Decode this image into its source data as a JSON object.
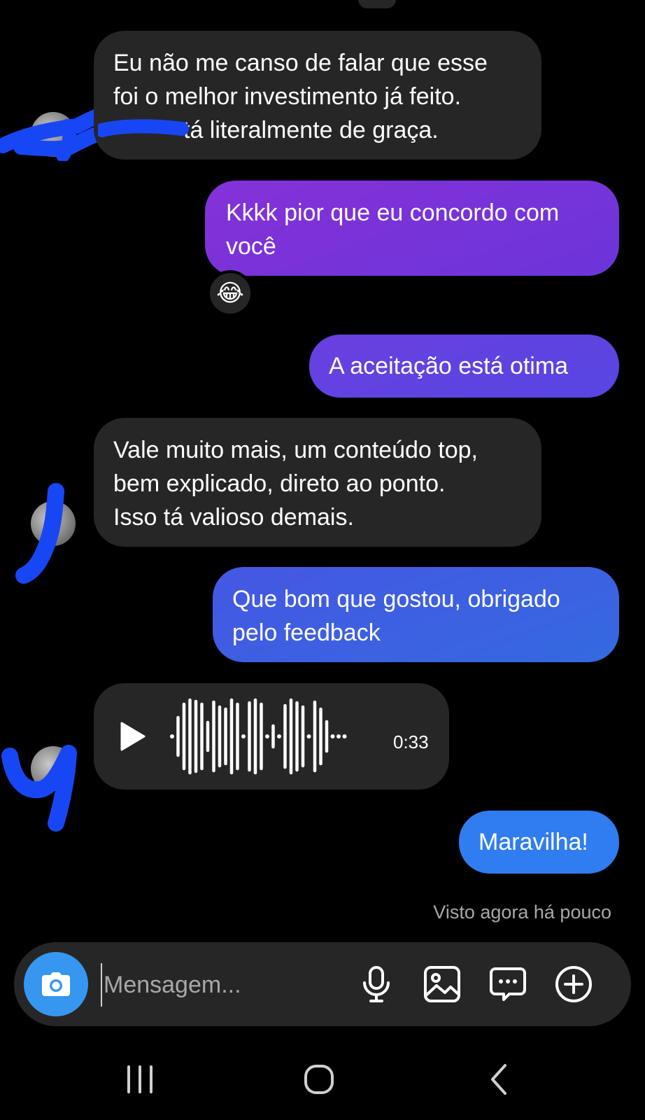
{
  "messages": {
    "m1": {
      "line1": "Eu não me canso de falar que esse",
      "line2": "foi o melhor investimento já feito.",
      "line3": "tá literalmente de graça."
    },
    "m2": {
      "line1": "Kkkk pior que eu concordo com",
      "line2": "você"
    },
    "m2_reaction": "😂",
    "m3": {
      "text": "A aceitação está otima"
    },
    "m4": {
      "line1": "Vale muito mais, um conteúdo top,",
      "line2": "bem explicado, direto ao ponto.",
      "line3": "Isso tá valioso demais."
    },
    "m5": {
      "line1": "Que bom que gostou, obrigado",
      "line2": "pelo feedback"
    },
    "voice": {
      "duration": "0:33"
    },
    "m6": {
      "text": "Maravilha!"
    }
  },
  "seen_status": "Visto agora há pouco",
  "composer": {
    "placeholder": "Mensagem...",
    "icons": [
      "camera-icon",
      "microphone-icon",
      "image-icon",
      "sticker-icon",
      "plus-icon"
    ]
  },
  "colors": {
    "incoming_bubble": "#262626",
    "outgoing_purple": "#7b2fd6",
    "outgoing_violet": "#6a3fe0",
    "outgoing_blue": "#3c62e2",
    "outgoing_light_blue": "#2f7df0",
    "camera_button": "#3797f0"
  }
}
